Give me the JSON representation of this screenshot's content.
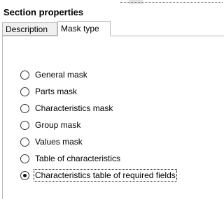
{
  "panel": {
    "title": "Section properties"
  },
  "tabs": [
    {
      "label": "Description",
      "active": false
    },
    {
      "label": "Mask type",
      "active": true
    }
  ],
  "mask_type": {
    "options": [
      {
        "label": "General mask",
        "checked": false
      },
      {
        "label": "Parts mask",
        "checked": false
      },
      {
        "label": "Characteristics mask",
        "checked": false
      },
      {
        "label": "Group mask",
        "checked": false
      },
      {
        "label": "Values mask",
        "checked": false
      },
      {
        "label": "Table of characteristics",
        "checked": false
      },
      {
        "label": "Characteristics table of required fields",
        "checked": true
      }
    ]
  }
}
